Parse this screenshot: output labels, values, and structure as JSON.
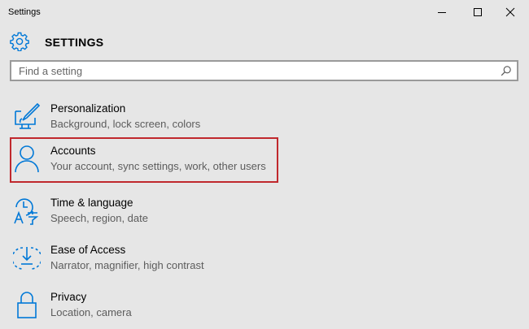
{
  "window": {
    "title": "Settings",
    "controls": [
      "minimize-icon",
      "maximize-icon",
      "close-icon"
    ]
  },
  "header": {
    "title": "SETTINGS",
    "icon": "gear-icon"
  },
  "search": {
    "placeholder": "Find a setting",
    "value": "",
    "icon": "search-icon"
  },
  "items": [
    {
      "label": "Personalization",
      "description": "Background, lock screen, colors",
      "icon": "personalization-icon"
    },
    {
      "label": "Accounts",
      "description": "Your account, sync settings, work, other users",
      "icon": "person-icon",
      "highlighted": true
    },
    {
      "label": "Time & language",
      "description": "Speech, region, date",
      "icon": "time-language-icon"
    },
    {
      "label": "Ease of Access",
      "description": "Narrator, magnifier, high contrast",
      "icon": "ease-of-access-icon"
    },
    {
      "label": "Privacy",
      "description": "Location, camera",
      "icon": "lock-icon"
    }
  ],
  "colors": {
    "accent": "#0078d7",
    "highlight_border": "#c0282d",
    "background": "#e6e6e6"
  }
}
